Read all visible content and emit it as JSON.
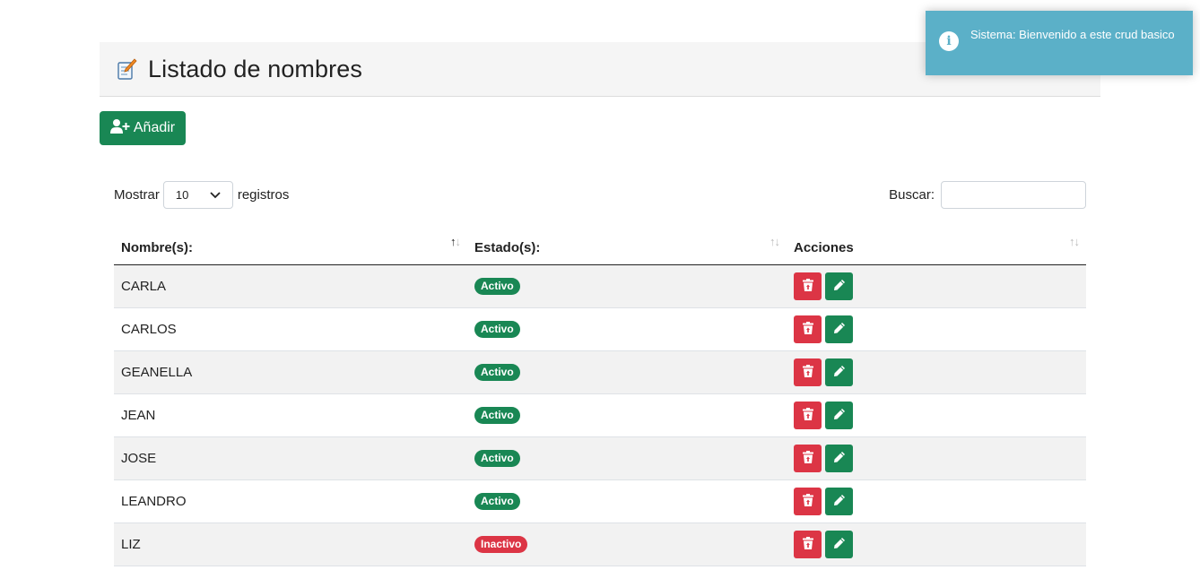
{
  "header": {
    "title": "Listado de nombres",
    "icon": "notebook-pencil-icon"
  },
  "toolbar": {
    "add_label": "Añadir",
    "add_icon": "user-plus-icon"
  },
  "table_controls": {
    "length_prefix": "Mostrar",
    "length_value": "10",
    "length_suffix": "registros",
    "search_label": "Buscar:",
    "search_value": ""
  },
  "table": {
    "columns": [
      "Nombre(s):",
      "Estado(s):",
      "Acciones"
    ],
    "sort_icon": "↑↓",
    "rows": [
      {
        "name": "CARLA",
        "status": "Activo",
        "active": true
      },
      {
        "name": "CARLOS",
        "status": "Activo",
        "active": true
      },
      {
        "name": "GEANELLA",
        "status": "Activo",
        "active": true
      },
      {
        "name": "JEAN",
        "status": "Activo",
        "active": true
      },
      {
        "name": "JOSE",
        "status": "Activo",
        "active": true
      },
      {
        "name": "LEANDRO",
        "status": "Activo",
        "active": true
      },
      {
        "name": "LIZ",
        "status": "Inactivo",
        "active": false
      }
    ]
  },
  "toast": {
    "message": "Sistema: Bienvenido a este crud basico",
    "icon": "info-icon"
  },
  "colors": {
    "success": "#198754",
    "danger": "#dc3545",
    "info": "#5bb0c8"
  }
}
